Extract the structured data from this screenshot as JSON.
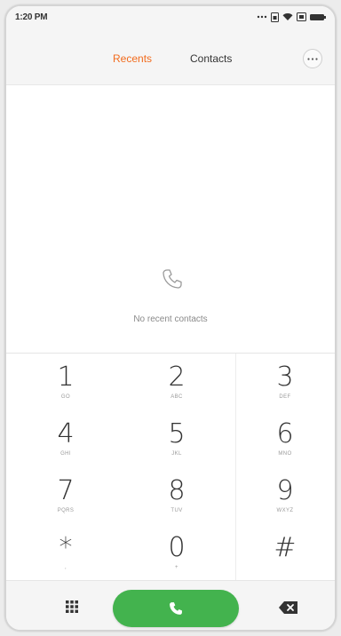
{
  "status_bar": {
    "time": "1:20 PM"
  },
  "header": {
    "tabs": [
      {
        "label": "Recents",
        "active": true
      },
      {
        "label": "Contacts",
        "active": false
      }
    ]
  },
  "recents": {
    "empty_message": "No recent contacts"
  },
  "keypad": {
    "keys": [
      {
        "digit": "1",
        "letters": "GO"
      },
      {
        "digit": "2",
        "letters": "ABC"
      },
      {
        "digit": "3",
        "letters": "DEF"
      },
      {
        "digit": "4",
        "letters": "GHI"
      },
      {
        "digit": "5",
        "letters": "JKL"
      },
      {
        "digit": "6",
        "letters": "MNO"
      },
      {
        "digit": "7",
        "letters": "PQRS"
      },
      {
        "digit": "8",
        "letters": "TUV"
      },
      {
        "digit": "9",
        "letters": "WXYZ"
      },
      {
        "digit": "*",
        "letters": ","
      },
      {
        "digit": "0",
        "letters": "+"
      },
      {
        "digit": "#",
        "letters": ""
      }
    ]
  },
  "icons": {
    "more": "more-horizontal-icon",
    "empty_state": "phone-outline-icon",
    "dialpad": "dialpad-grid-icon",
    "call": "phone-icon",
    "backspace": "backspace-icon"
  },
  "colors": {
    "accent": "#f26b1d",
    "call_button": "#43b34e",
    "background": "#ffffff",
    "bar_background": "#f5f5f5"
  }
}
